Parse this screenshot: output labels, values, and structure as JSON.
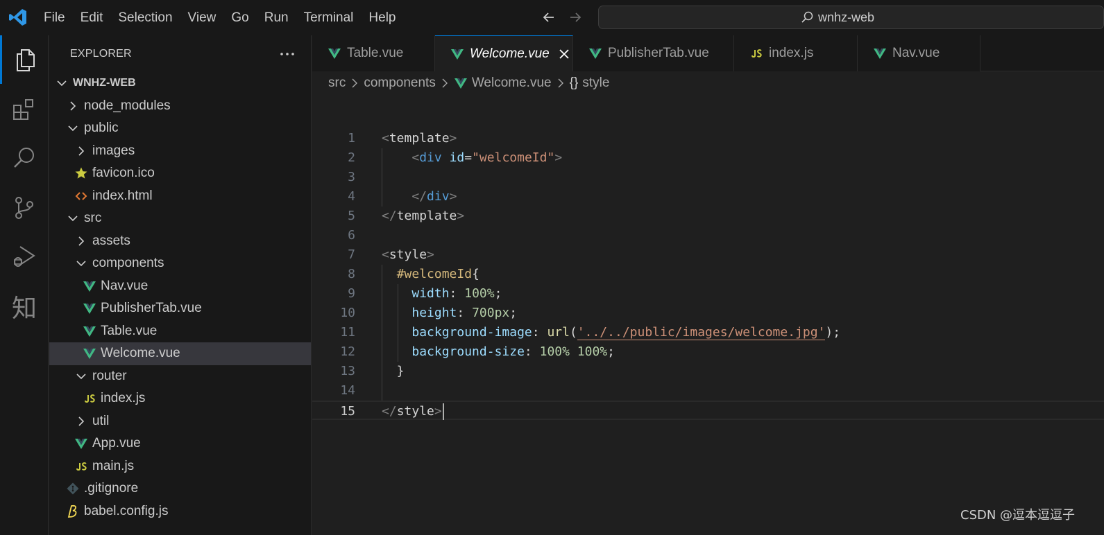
{
  "titlebar": {
    "menu": [
      "File",
      "Edit",
      "Selection",
      "View",
      "Go",
      "Run",
      "Terminal",
      "Help"
    ],
    "search_text": "wnhz-web"
  },
  "sidebar": {
    "header": "EXPLORER",
    "tree": [
      {
        "label": "WNHZ-WEB",
        "kind": "root",
        "depth": 0,
        "expanded": true
      },
      {
        "label": "node_modules",
        "kind": "folder",
        "depth": 1,
        "expanded": false
      },
      {
        "label": "public",
        "kind": "folder",
        "depth": 1,
        "expanded": true
      },
      {
        "label": "images",
        "kind": "folder",
        "depth": 2,
        "expanded": false
      },
      {
        "label": "favicon.ico",
        "kind": "favicon",
        "depth": 2
      },
      {
        "label": "index.html",
        "kind": "html",
        "depth": 2
      },
      {
        "label": "src",
        "kind": "folder",
        "depth": 1,
        "expanded": true
      },
      {
        "label": "assets",
        "kind": "folder",
        "depth": 2,
        "expanded": false
      },
      {
        "label": "components",
        "kind": "folder",
        "depth": 2,
        "expanded": true
      },
      {
        "label": "Nav.vue",
        "kind": "vue",
        "depth": 3
      },
      {
        "label": "PublisherTab.vue",
        "kind": "vue",
        "depth": 3
      },
      {
        "label": "Table.vue",
        "kind": "vue",
        "depth": 3
      },
      {
        "label": "Welcome.vue",
        "kind": "vue",
        "depth": 3,
        "selected": true
      },
      {
        "label": "router",
        "kind": "folder",
        "depth": 2,
        "expanded": true
      },
      {
        "label": "index.js",
        "kind": "js",
        "depth": 3
      },
      {
        "label": "util",
        "kind": "folder",
        "depth": 2,
        "expanded": false
      },
      {
        "label": "App.vue",
        "kind": "vue",
        "depth": 2
      },
      {
        "label": "main.js",
        "kind": "js",
        "depth": 2
      },
      {
        "label": ".gitignore",
        "kind": "git",
        "depth": 1
      },
      {
        "label": "babel.config.js",
        "kind": "babel",
        "depth": 1
      }
    ]
  },
  "tabs": [
    {
      "label": "Table.vue",
      "kind": "vue",
      "width": 177
    },
    {
      "label": "Welcome.vue",
      "kind": "vue",
      "active": true,
      "width": 199
    },
    {
      "label": "PublisherTab.vue",
      "kind": "vue",
      "width": 232
    },
    {
      "label": "index.js",
      "kind": "js",
      "width": 178
    },
    {
      "label": "Nav.vue",
      "kind": "vue",
      "width": 177
    }
  ],
  "breadcrumb": {
    "items": [
      "src",
      "components",
      "Welcome.vue",
      "style"
    ],
    "braces": "{}"
  },
  "editor": {
    "current_line": 15,
    "lines": [
      [
        [
          "t-punc",
          "<"
        ],
        [
          "t-plain",
          "template"
        ],
        [
          "t-punc",
          ">"
        ]
      ],
      [
        [
          "t-plain",
          "    "
        ],
        [
          "t-punc",
          "<"
        ],
        [
          "t-tag",
          "div"
        ],
        [
          "t-plain",
          " "
        ],
        [
          "t-attr",
          "id"
        ],
        [
          "t-plain",
          "="
        ],
        [
          "t-str",
          "\"welcomeId\""
        ],
        [
          "t-punc",
          ">"
        ]
      ],
      [],
      [
        [
          "t-plain",
          "    "
        ],
        [
          "t-punc",
          "</"
        ],
        [
          "t-tag",
          "div"
        ],
        [
          "t-punc",
          ">"
        ]
      ],
      [
        [
          "t-punc",
          "</"
        ],
        [
          "t-plain",
          "template"
        ],
        [
          "t-punc",
          ">"
        ]
      ],
      [],
      [
        [
          "t-punc",
          "<"
        ],
        [
          "t-plain",
          "style"
        ],
        [
          "t-punc",
          ">"
        ]
      ],
      [
        [
          "t-plain",
          "  "
        ],
        [
          "t-sel",
          "#welcomeId"
        ],
        [
          "t-plain",
          "{"
        ]
      ],
      [
        [
          "t-plain",
          "    "
        ],
        [
          "t-attr",
          "width"
        ],
        [
          "t-plain",
          ": "
        ],
        [
          "t-num",
          "100%"
        ],
        [
          "t-plain",
          ";"
        ]
      ],
      [
        [
          "t-plain",
          "    "
        ],
        [
          "t-attr",
          "height"
        ],
        [
          "t-plain",
          ": "
        ],
        [
          "t-num",
          "700px"
        ],
        [
          "t-plain",
          ";"
        ]
      ],
      [
        [
          "t-plain",
          "    "
        ],
        [
          "t-attr",
          "background-image"
        ],
        [
          "t-plain",
          ": "
        ],
        [
          "t-fn",
          "url"
        ],
        [
          "t-plain",
          "("
        ],
        [
          "t-url",
          "'../../public/images/welcome.jpg'"
        ],
        [
          "t-plain",
          ");"
        ]
      ],
      [
        [
          "t-plain",
          "    "
        ],
        [
          "t-attr",
          "background-size"
        ],
        [
          "t-plain",
          ": "
        ],
        [
          "t-num",
          "100% 100%"
        ],
        [
          "t-plain",
          ";"
        ]
      ],
      [
        [
          "t-plain",
          "  }"
        ]
      ],
      [],
      [
        [
          "t-punc",
          "</"
        ],
        [
          "t-plain",
          "style"
        ],
        [
          "t-punc",
          ">"
        ]
      ]
    ]
  },
  "watermark": "CSDN @逗本逗逗子",
  "icons": {
    "logo": "vscode-logo-icon",
    "vue_color": "#41b883",
    "js_color": "#cbcb41",
    "accent": "#0078d4"
  }
}
